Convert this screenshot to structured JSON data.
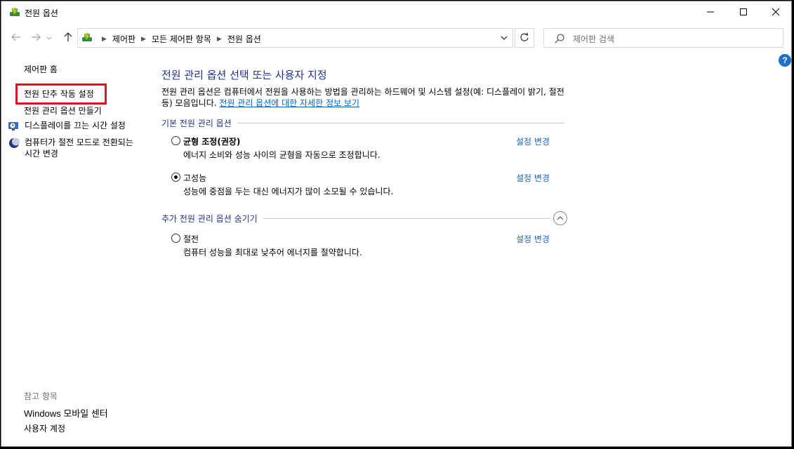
{
  "window": {
    "title": "전원 옵션",
    "controls": {
      "minimize": "minimize-icon",
      "maximize": "maximize-icon",
      "close": "close-icon"
    }
  },
  "nav": {
    "breadcrumbs": [
      "제어판",
      "모든 제어판 항목",
      "전원 옵션"
    ],
    "search_placeholder": "제어판 검색"
  },
  "sidebar": {
    "home": "제어판 홈",
    "power_button": "전원 단추 작동 설정",
    "create_plan": "전원 관리 옵션 만들기",
    "display_off": "디스플레이를 끄는 시간 설정",
    "sleep": "컴퓨터가 절전 모드로 전환되는 시간 변경",
    "see_also": "참고 항목",
    "mobility_center": "Windows 모바일 센터",
    "user_accounts": "사용자 계정"
  },
  "main": {
    "title": "전원 관리 옵션 선택 또는 사용자 지정",
    "description": "전원 관리 옵션은 컴퓨터에서 전원을 사용하는 방법을 관리하는 하드웨어 및 시스템 설정(예: 디스플레이 밝기, 절전 등) 모음입니다.",
    "more_info_link": "전원 관리 옵션에 대한 자세한 정보 보기",
    "section_basic": "기본 전원 관리 옵션",
    "section_more": "추가 전원 관리 옵션 숨기기",
    "change_label": "설정 변경",
    "plans": [
      {
        "name": "균형 조정(권장)",
        "desc": "에너지 소비와 성능 사이의 균형을 자동으로 조정합니다.",
        "selected": false
      },
      {
        "name": "고성능",
        "desc": "성능에 중점을 두는 대신 에너지가 많이 소모될 수 있습니다.",
        "selected": true
      },
      {
        "name": "절전",
        "desc": "컴퓨터 성능을 최대로 낮추어 에너지를 절약합니다.",
        "selected": false
      }
    ]
  },
  "colors": {
    "heading": "#1e3287",
    "link": "#1e64b4",
    "highlight_box": "#e0141e",
    "help": "#1e6fc8"
  }
}
